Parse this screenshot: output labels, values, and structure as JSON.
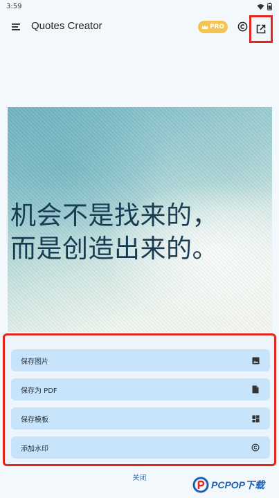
{
  "status_bar": {
    "time": "3:59"
  },
  "app_bar": {
    "title": "Quotes Creator",
    "pro_badge": "PRO"
  },
  "quote": {
    "lines": [
      "机会不是找来的，",
      "而是创造出来的。"
    ]
  },
  "actions": [
    {
      "label": "保存图片",
      "icon": "image-icon"
    },
    {
      "label": "保存为 PDF",
      "icon": "document-icon"
    },
    {
      "label": "保存模板",
      "icon": "template-icon"
    },
    {
      "label": "添加水印",
      "icon": "copyright-icon"
    }
  ],
  "close_label": "关闭",
  "watermark": {
    "text": "PCPOP下载"
  },
  "colors": {
    "accent": "#3a6fa6",
    "pro": "#f2c451",
    "highlight": "#e3261d",
    "button_bg": "#c8e4fb",
    "quote_text": "#173c54"
  }
}
